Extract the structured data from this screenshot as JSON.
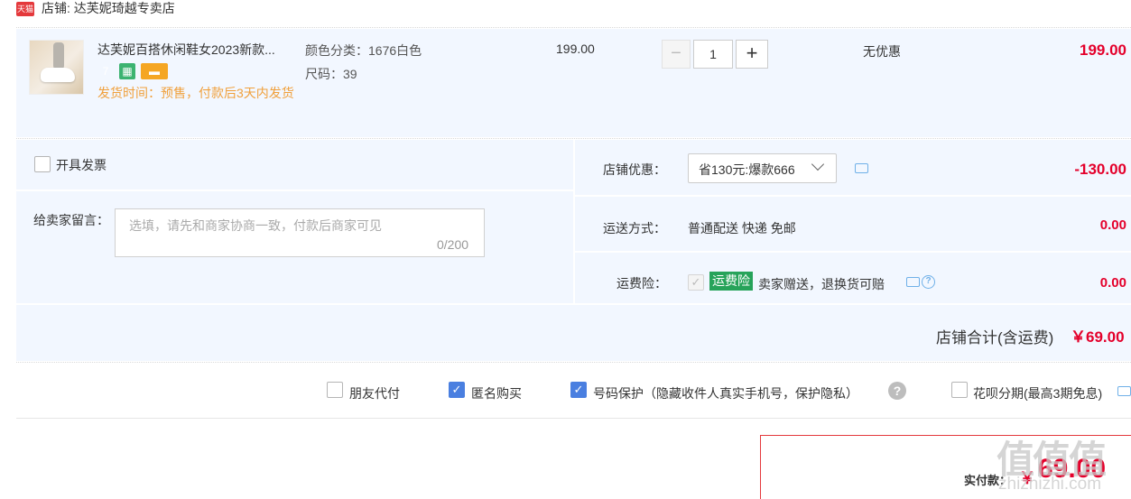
{
  "shop": {
    "badge": "天猫",
    "label": "店铺: 达芙妮琦越专卖店"
  },
  "item": {
    "title": "达芙妮百搭休闲鞋女2023新款...",
    "tags": [
      {
        "text": "7",
        "color": "#2bb673"
      },
      {
        "text": "▦",
        "color": "#3cb371"
      },
      {
        "text": "▬",
        "color": "#f5a623"
      }
    ],
    "ship_time": "发货时间：预售，付款后3天内发货",
    "color_spec": "颜色分类：1676白色",
    "size_spec": "尺码：39",
    "unit_price": "199.00",
    "quantity": "1",
    "minus": "−",
    "plus": "+",
    "discount": "无优惠",
    "subtotal": "199.00"
  },
  "invoice_label": "开具发票",
  "memo": {
    "label": "给卖家留言：",
    "placeholder": "选填，请先和商家协商一致，付款后商家可见",
    "counter": "0/200"
  },
  "shop_discount": {
    "label": "店铺优惠：",
    "selected": "省130元:爆款666",
    "amount": "-130.00"
  },
  "shipping": {
    "label": "运送方式：",
    "value": "普通配送 快递 免邮",
    "amount": "0.00"
  },
  "insurance": {
    "label": "运费险：",
    "badge": "运费险",
    "desc": "卖家赠送，退换货可赔",
    "help": "?",
    "amount": "0.00"
  },
  "shop_total": {
    "label": "店铺合计(含运费)",
    "amount": "￥69.00"
  },
  "options": [
    {
      "label": "朋友代付",
      "checked": false
    },
    {
      "label": "匿名购买",
      "checked": true
    },
    {
      "label": "号码保护（隐藏收件人真实手机号，保护隐私）",
      "checked": true
    },
    {
      "label": "花呗分期(最高3期免息)",
      "checked": false
    }
  ],
  "option_help": "?",
  "payment": {
    "label": "实付款：",
    "yen": "￥",
    "amount": "69.00"
  },
  "watermark": {
    "glyphs": "值值值",
    "site": "zhizhizhi.com"
  }
}
